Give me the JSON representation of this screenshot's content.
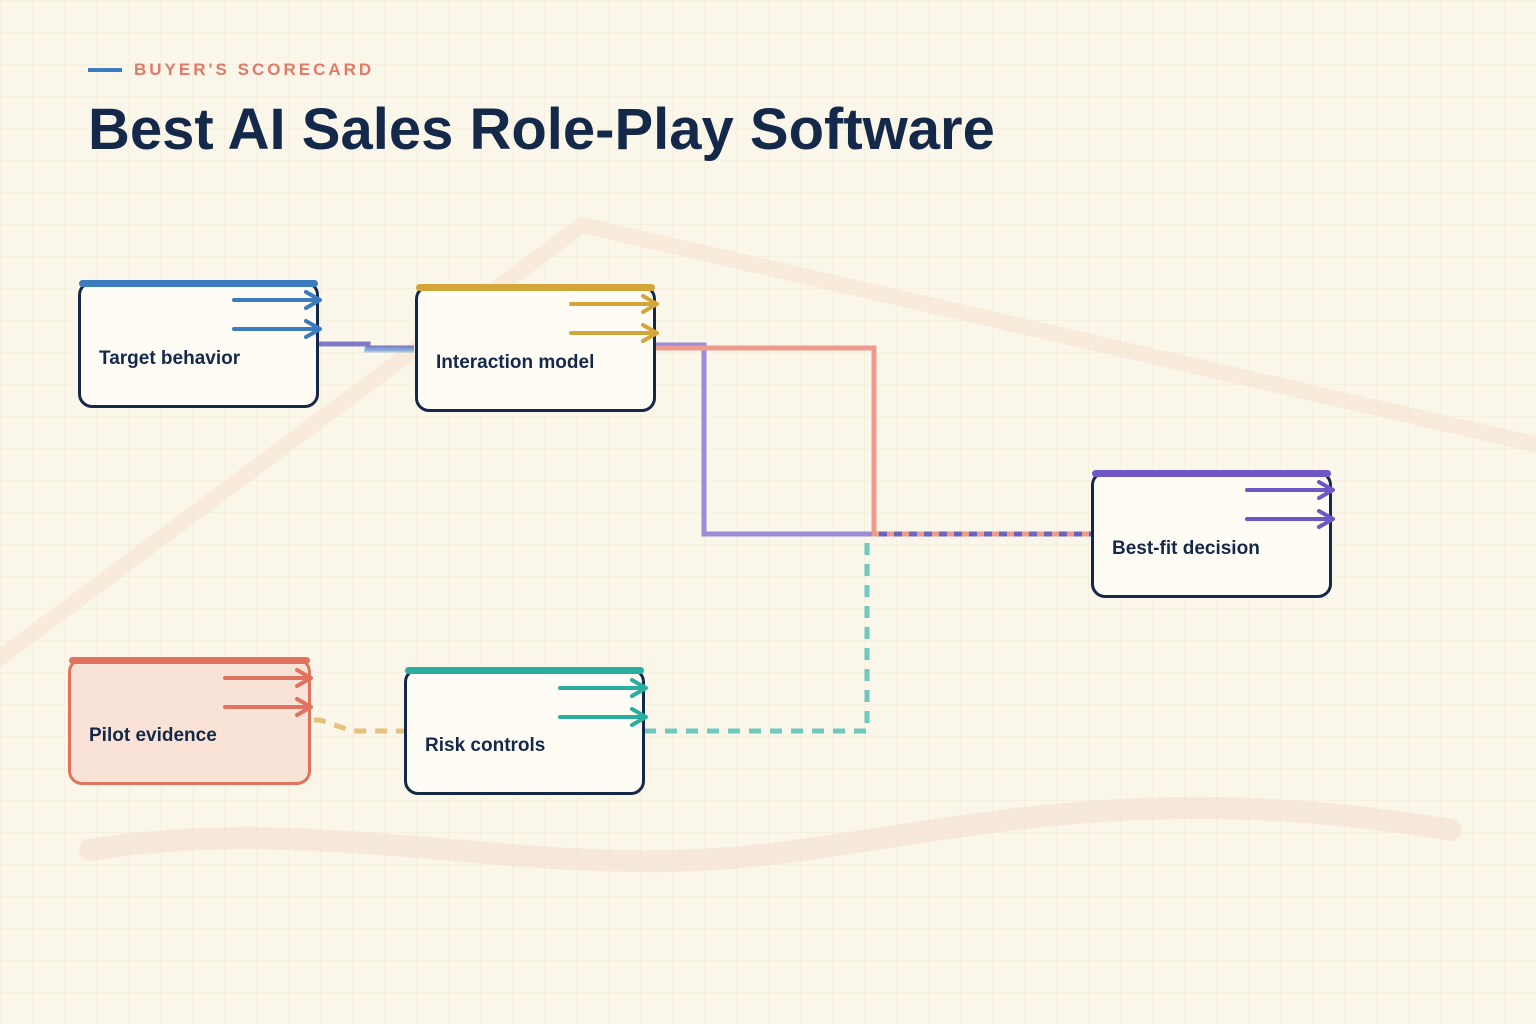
{
  "header": {
    "kicker": "BUYER'S SCORECARD",
    "title": "Best AI Sales Role-Play Software"
  },
  "nodes": [
    {
      "id": "target",
      "label": "Target behavior",
      "color": "#3b7bbf"
    },
    {
      "id": "interaction",
      "label": "Interaction model",
      "color": "#d4a63a"
    },
    {
      "id": "decision",
      "label": "Best-fit decision",
      "color": "#6e57c4"
    },
    {
      "id": "pilot",
      "label": "Pilot evidence",
      "color": "#e07360",
      "fill": "#f9e3d6",
      "border": "#e07360"
    },
    {
      "id": "risk",
      "label": "Risk controls",
      "color": "#2aaea0"
    }
  ],
  "colors": {
    "background": "#fbf6ea",
    "ink": "#14294a",
    "accent_blue": "#3b7bbf",
    "accent_gold": "#d4a63a",
    "accent_purple": "#6e57c4",
    "accent_coral": "#e07360",
    "accent_teal": "#2aaea0",
    "connector_purple": "#9d8bd6",
    "connector_salmon": "#ec9c8c",
    "connector_teal": "#6fcabd",
    "connector_sand": "#e4c27d",
    "connector_indigo": "#6a64c0"
  },
  "icons": [
    "arrow-right-icon"
  ]
}
